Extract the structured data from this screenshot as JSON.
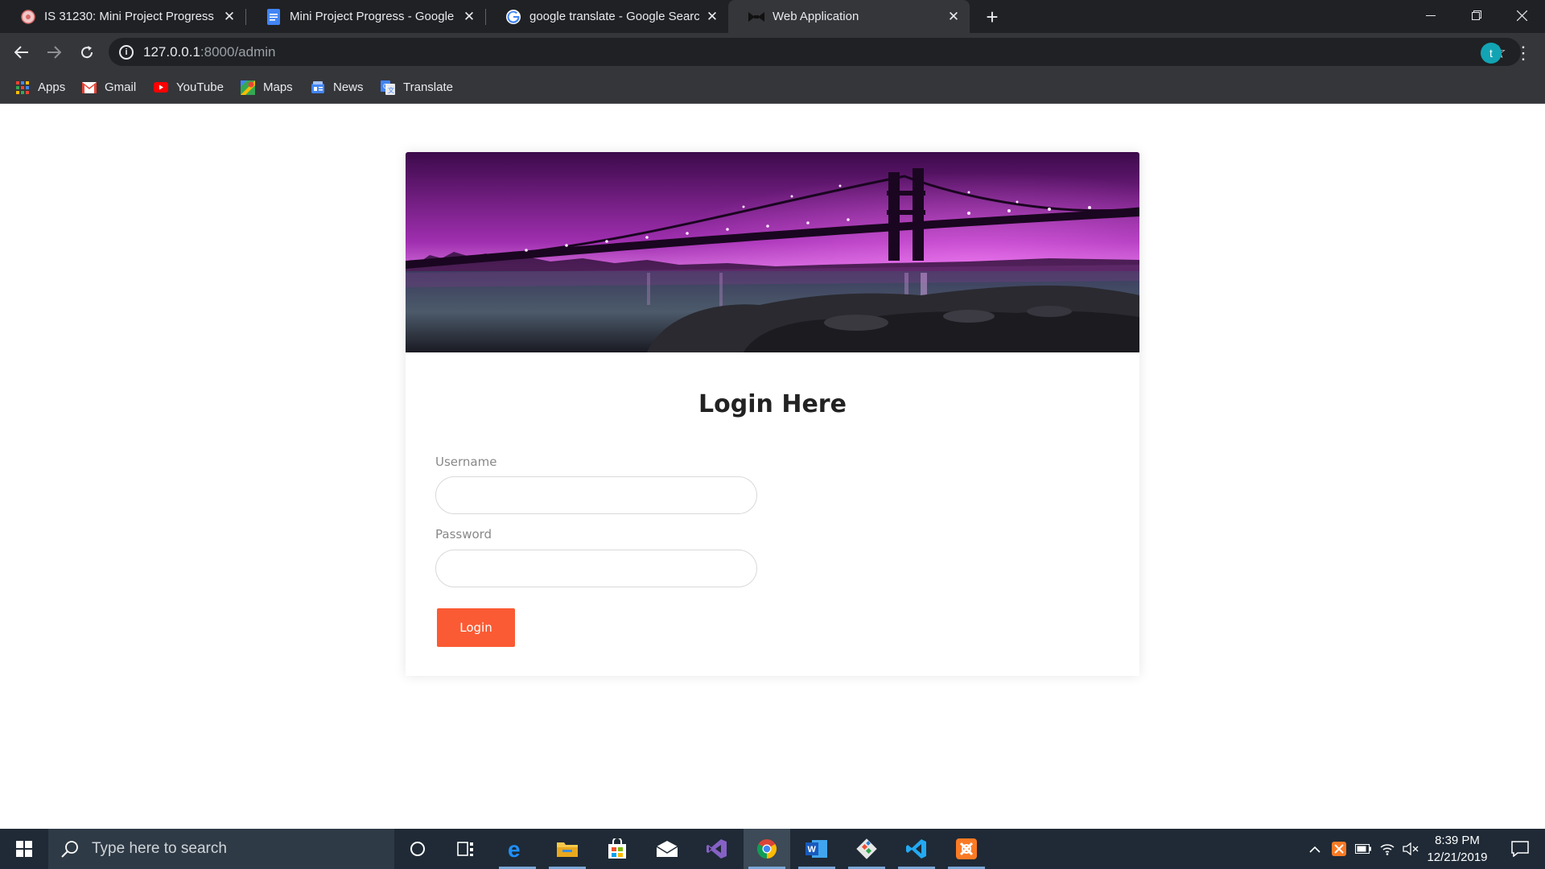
{
  "browser": {
    "tabs": [
      {
        "title": "IS 31230: Mini Project Progress",
        "close": "✕",
        "active": false
      },
      {
        "title": "Mini Project Progress - Google D",
        "close": "✕",
        "active": false
      },
      {
        "title": "google translate - Google Search",
        "close": "✕",
        "active": false
      },
      {
        "title": "Web Application",
        "close": "✕",
        "active": true
      }
    ],
    "new_tab": "+",
    "window_controls": {
      "minimize": "—",
      "restore": "❐",
      "close": "✕"
    },
    "address": {
      "host": "127.0.0.1",
      "rest": ":8000/admin"
    },
    "profile_initial": "t",
    "bookmarks": [
      {
        "label": "Apps",
        "icon": "apps-grid-icon"
      },
      {
        "label": "Gmail",
        "icon": "gmail-icon"
      },
      {
        "label": "YouTube",
        "icon": "youtube-icon"
      },
      {
        "label": "Maps",
        "icon": "maps-icon"
      },
      {
        "label": "News",
        "icon": "news-icon"
      },
      {
        "label": "Translate",
        "icon": "translate-icon"
      }
    ]
  },
  "page": {
    "heading": "Login Here",
    "username_label": "Username",
    "username_value": "",
    "password_label": "Password",
    "password_value": "",
    "login_button": "Login",
    "accent_color": "#fa5b34"
  },
  "taskbar": {
    "search_placeholder": "Type here to search",
    "time": "8:39 PM",
    "date": "12/21/2019",
    "pinned": [
      "cortana-icon",
      "task-view-icon",
      "edge-icon",
      "file-explorer-icon",
      "store-icon",
      "mail-icon",
      "visual-studio-icon",
      "chrome-icon",
      "word-icon",
      "git-icon",
      "vscode-icon",
      "xampp-icon"
    ]
  }
}
